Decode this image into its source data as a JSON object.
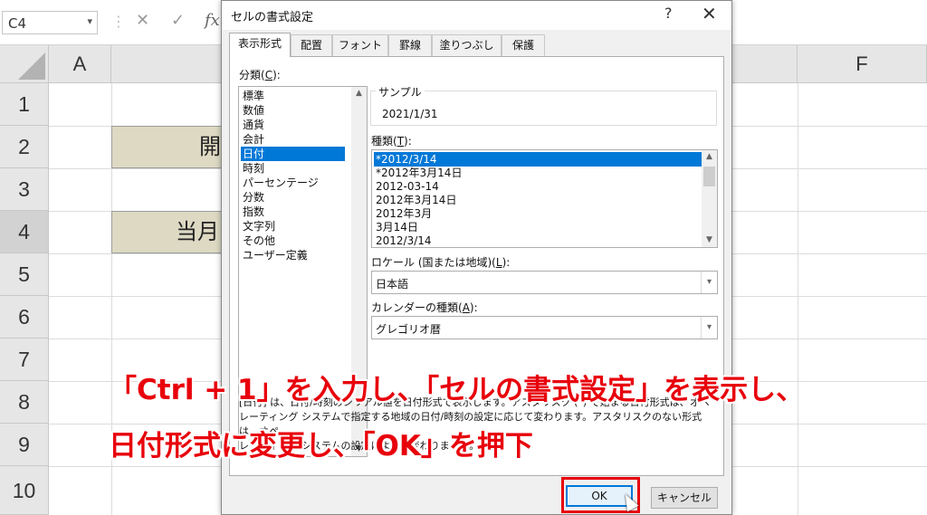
{
  "formula_bar": {
    "name_box": "C4",
    "name_box_arrow": "▾",
    "separator": "⋮",
    "cancel_glyph": "✕",
    "enter_glyph": "✓",
    "fx_glyph": "fx"
  },
  "sheet": {
    "columns": [
      "A",
      "F"
    ],
    "rows": [
      "1",
      "2",
      "3",
      "4",
      "5",
      "6",
      "7",
      "8",
      "9",
      "10"
    ],
    "active_row": "4",
    "cells": {
      "c2_partial": "開",
      "c4_partial": "当月"
    }
  },
  "dialog": {
    "title": "セルの書式設定",
    "help": "?",
    "close": "✕",
    "tabs": [
      "表示形式",
      "配置",
      "フォント",
      "罫線",
      "塗りつぶし",
      "保護"
    ],
    "active_tab": "表示形式",
    "category": {
      "label_pre": "分類(",
      "label_key": "C",
      "label_post": "):",
      "items": [
        "標準",
        "数値",
        "通貨",
        "会計",
        "日付",
        "時刻",
        "パーセンテージ",
        "分数",
        "指数",
        "文字列",
        "その他",
        "ユーザー定義"
      ],
      "selected": "日付"
    },
    "sample": {
      "label": "サンプル",
      "value": "2021/1/31"
    },
    "type": {
      "label_pre": "種類(",
      "label_key": "T",
      "label_post": "):",
      "items": [
        "*2012/3/14",
        "*2012年3月14日",
        "2012-03-14",
        "2012年3月14日",
        "2012年3月",
        "3月14日",
        "2012/3/14"
      ],
      "selected": "*2012/3/14"
    },
    "locale": {
      "label_pre": "ロケール (国または地域)(",
      "label_key": "L",
      "label_post": "):",
      "value": "日本語"
    },
    "calendar": {
      "label_pre": "カレンダーの種類(",
      "label_key": "A",
      "label_post": "):",
      "value": "グレゴリオ暦"
    },
    "description_line1": "[日付] は、日付/時刻のシリアル値を日付形式で表示します。アスタリスク (*) で始まる日付形式は、オペ",
    "description_line2": "レーティング システムで指定する地域の日付/時刻の設定に応じて変わります。アスタリスクのない形式は、オペ",
    "description_line3": "レーティング システムの設定によって変わりません。",
    "ok": "OK",
    "cancel": "キャンセル"
  },
  "annotation": {
    "line1": "「Ctrl + 1」を入力し、「セルの書式設定」を表示し、",
    "line2": "日付形式に変更し、「OK」を押下"
  },
  "colors": {
    "accent": "#0078d7",
    "annotation_red": "#e8000b",
    "filled_cell": "#ddd9c3",
    "header_bg": "#e6e6e6"
  },
  "icons": [
    "dropdown-arrow-icon",
    "cancel-icon",
    "enter-icon",
    "fx-icon",
    "help-icon",
    "close-icon",
    "scroll-up-icon",
    "scroll-down-icon",
    "combo-arrow-icon",
    "mouse-cursor-icon"
  ]
}
